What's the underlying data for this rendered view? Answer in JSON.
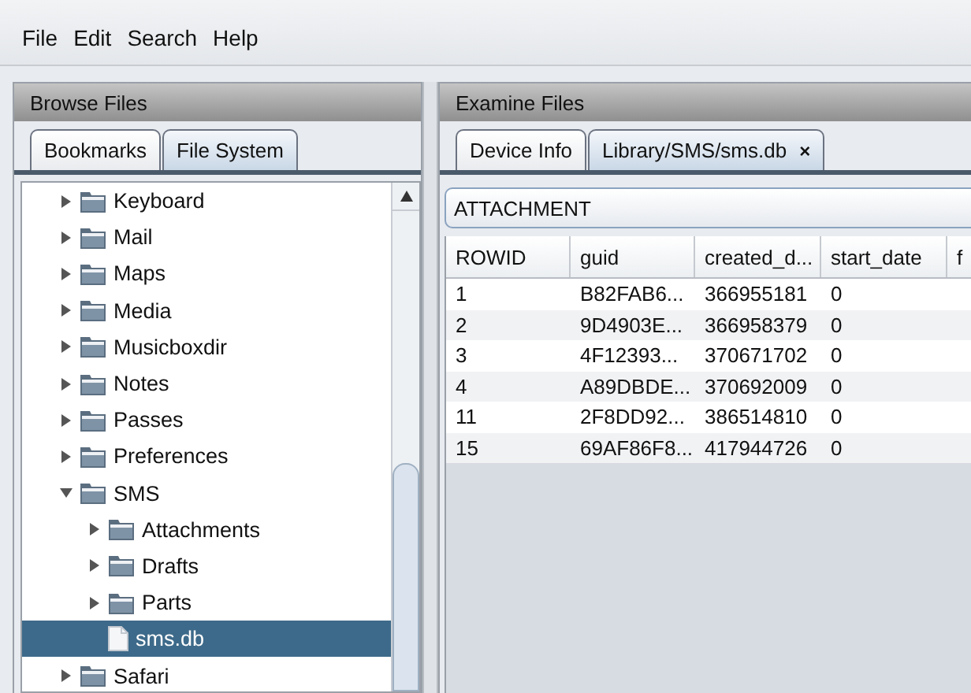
{
  "menu": [
    {
      "label": "File"
    },
    {
      "label": "Edit"
    },
    {
      "label": "Search"
    },
    {
      "label": "Help"
    }
  ],
  "browse": {
    "title": "Browse Files",
    "tabs": [
      {
        "label": "Bookmarks",
        "selected": false
      },
      {
        "label": "File System",
        "selected": true
      }
    ],
    "tree": [
      {
        "label": "Keyboard",
        "kind": "folder",
        "expanded": false,
        "selected": false
      },
      {
        "label": "Mail",
        "kind": "folder",
        "expanded": false,
        "selected": false
      },
      {
        "label": "Maps",
        "kind": "folder",
        "expanded": false,
        "selected": false
      },
      {
        "label": "Media",
        "kind": "folder",
        "expanded": false,
        "selected": false
      },
      {
        "label": "Musicboxdir",
        "kind": "folder",
        "expanded": false,
        "selected": false
      },
      {
        "label": "Notes",
        "kind": "folder",
        "expanded": false,
        "selected": false
      },
      {
        "label": "Passes",
        "kind": "folder",
        "expanded": false,
        "selected": false
      },
      {
        "label": "Preferences",
        "kind": "folder",
        "expanded": false,
        "selected": false
      },
      {
        "label": "SMS",
        "kind": "folder",
        "expanded": true,
        "selected": false,
        "children": [
          {
            "label": "Attachments",
            "kind": "folder",
            "expanded": false,
            "selected": false
          },
          {
            "label": "Drafts",
            "kind": "folder",
            "expanded": false,
            "selected": false
          },
          {
            "label": "Parts",
            "kind": "folder",
            "expanded": false,
            "selected": false
          },
          {
            "label": "sms.db",
            "kind": "file",
            "selected": true
          }
        ]
      },
      {
        "label": "Safari",
        "kind": "folder",
        "expanded": false,
        "selected": false
      }
    ]
  },
  "examine": {
    "title": "Examine Files",
    "tabs": [
      {
        "label": "Device Info",
        "selected": false
      },
      {
        "label": "Library/SMS/sms.db",
        "selected": true,
        "close": "×"
      }
    ],
    "table_name": "ATTACHMENT",
    "table": {
      "columns": [
        "ROWID",
        "guid",
        "created_d...",
        "start_date",
        "f"
      ],
      "rows": [
        [
          "1",
          "B82FAB6...",
          "366955181",
          "0"
        ],
        [
          "2",
          "9D4903E...",
          "366958379",
          "0"
        ],
        [
          "3",
          "4F12393...",
          "370671702",
          "0"
        ],
        [
          "4",
          "A89DBDE...",
          "370692009",
          "0"
        ],
        [
          "11",
          "2F8DD92...",
          "386514810",
          "0"
        ],
        [
          "15",
          "69AF86F8...",
          "417944726",
          "0"
        ]
      ]
    }
  }
}
